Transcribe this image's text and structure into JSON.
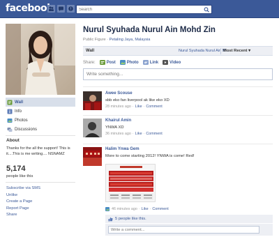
{
  "topbar": {
    "logo": "facebook",
    "search_placeholder": "Search"
  },
  "profile": {
    "name": "Nurul Syuhada Nurul Ain Mohd Zin",
    "category": "Public Figure",
    "separator": " · ",
    "location": "Petaling Jaya, Malaysia"
  },
  "nav": {
    "items": [
      {
        "label": "Wall"
      },
      {
        "label": "Info"
      },
      {
        "label": "Photos"
      },
      {
        "label": "Discussions"
      }
    ]
  },
  "about": {
    "title": "About",
    "text": "Thanks for the all the support! This is it....This is me writing.... NSNAMZ"
  },
  "likes": {
    "count": "5,174",
    "label": "people like this"
  },
  "side_links": [
    "Subscribe via SMS",
    "Unlike",
    "Create a Page",
    "Report Page",
    "Share"
  ],
  "wall": {
    "label": "Wall",
    "filter": "Nurul Syuhada Nurul Ain M...",
    "sort": "Most Recent",
    "sort_arrow": "▾"
  },
  "share": {
    "label": "Share:",
    "items": [
      "Post",
      "Photo",
      "Link",
      "Video"
    ]
  },
  "composer": {
    "placeholder": "Write something..."
  },
  "posts": [
    {
      "author": "Awee Scouse",
      "text": "sbb eko fan liverpool ak like eko XD",
      "time": "28 minutes ago",
      "like": "Like",
      "comment": "Comment",
      "dot": "·"
    },
    {
      "author": "Khairul Amin",
      "text": "YNWA XD",
      "time": "36 minutes ago",
      "like": "Like",
      "comment": "Comment",
      "dot": "·"
    },
    {
      "author": "Halim Ynwa Gem",
      "text": "More to come starting 2012! YNWA is come! Red!",
      "time": "46 minutes ago",
      "like": "Like",
      "comment": "Comment",
      "dot": "·",
      "poster_title": "THE OFFICIAL LIVERPOOL CLUB"
    }
  ],
  "post_likes": {
    "text": "5 people like this."
  },
  "comment": {
    "placeholder": "Write a comment..."
  },
  "colors": {
    "brand_blue": "#3b5998",
    "nav_active": "#d8dfea",
    "wallbar_bg": "#edeff4"
  },
  "icons": [
    "friend-requests-icon",
    "messages-icon",
    "notifications-icon",
    "search-icon",
    "wall-icon",
    "info-icon",
    "photos-icon",
    "discussions-icon",
    "post-icon",
    "photo-icon",
    "link-icon",
    "video-icon",
    "thumbs-up-icon"
  ]
}
